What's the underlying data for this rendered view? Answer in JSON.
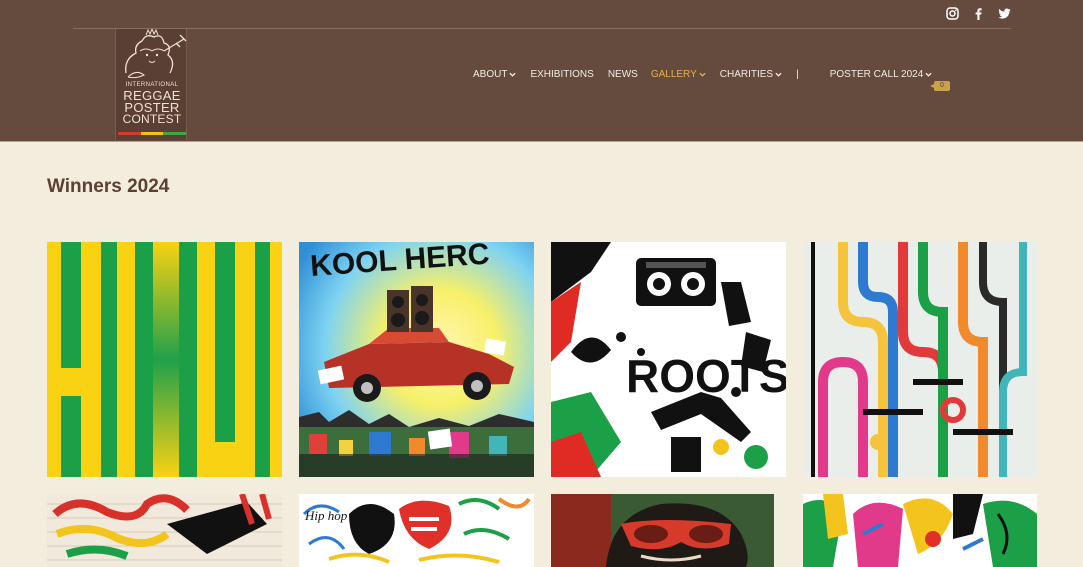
{
  "header": {
    "logo": {
      "line1": "INTERNATIONAL",
      "line2": "REGGAE",
      "line3": "POSTER",
      "line4": "CONTEST",
      "flag_colors": [
        "#d63a2f",
        "#f1c40f",
        "#3aa845"
      ]
    },
    "social": [
      "instagram-icon",
      "facebook-icon",
      "twitter-icon"
    ],
    "nav": [
      {
        "label": "ABOUT",
        "dropdown": true
      },
      {
        "label": "EXHIBITIONS",
        "dropdown": false
      },
      {
        "label": "NEWS",
        "dropdown": false
      },
      {
        "label": "GALLERY",
        "dropdown": true,
        "active": true
      },
      {
        "label": "CHARITIES",
        "dropdown": true
      },
      {
        "label": "|",
        "dropdown": false
      },
      {
        "label": "POSTER CALL 2024",
        "dropdown": true
      }
    ],
    "cart_count": "0"
  },
  "page": {
    "title": "Winners 2024"
  },
  "gallery": {
    "items": [
      {
        "subject": "green-yellow-hiu-letters"
      },
      {
        "text": "KOOL HERC",
        "subject": "red-convertible-car-with-speakers"
      },
      {
        "text": "ROOTS",
        "subject": "boombox-and-microphone"
      },
      {
        "subject": "colorful-hip-hop-pipes"
      },
      {
        "subject": "graffiti-brick-wall"
      },
      {
        "text": "Hip hop",
        "subject": "hip-hop-lettering"
      },
      {
        "subject": "man-with-red-glasses"
      },
      {
        "subject": "colorful-dancers"
      }
    ]
  },
  "colors": {
    "header_bg": "#654a3e",
    "page_bg": "#f3eddd",
    "nav_active": "#e8b04b",
    "nav_text": "#f3ebe4",
    "title": "#5c4034"
  }
}
